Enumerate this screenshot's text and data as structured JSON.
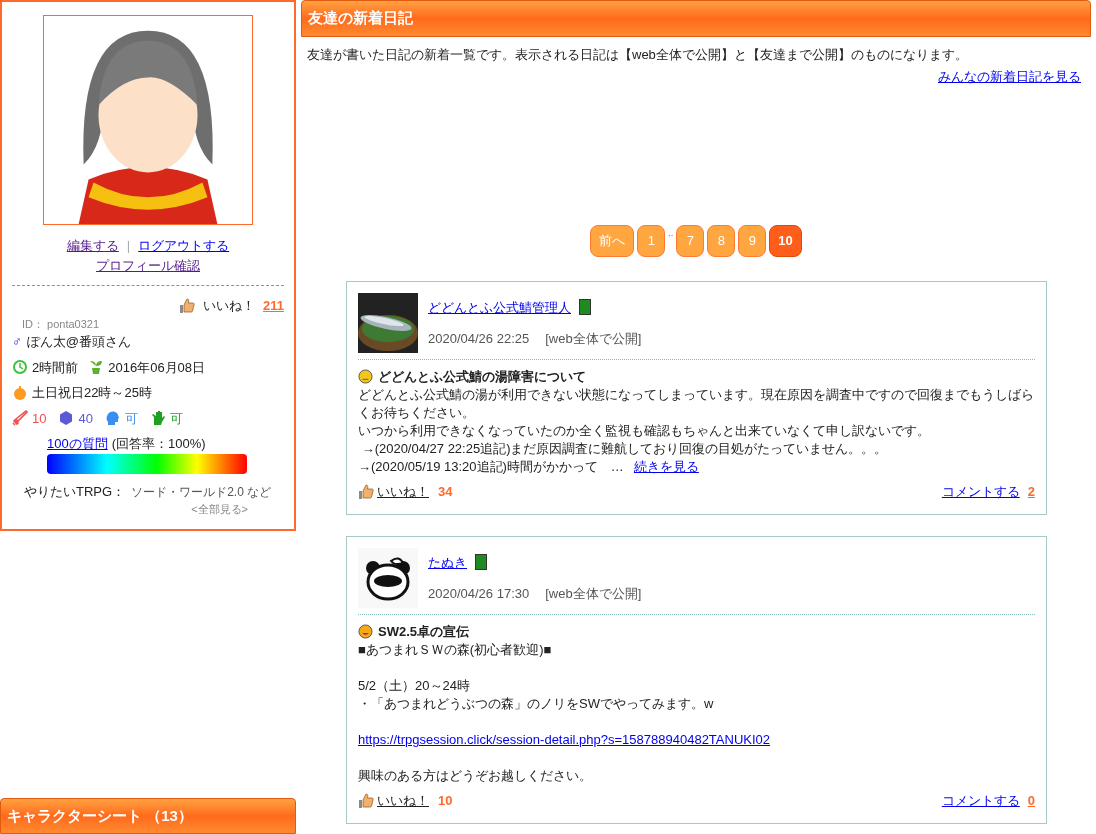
{
  "profile": {
    "links": [
      "編集する",
      "ログアウトする"
    ],
    "separator": "|",
    "profile_link": "プロフィール確認",
    "likes_label": "いいね！",
    "likes_count": "211",
    "id": "ID： ponta0321",
    "gender_mark": "♂",
    "name": "ぽん太@番頭さん",
    "last_login": "2時間前",
    "joined": "2016年06月08日",
    "schedule": "土日祝日22時～25時",
    "stats": [
      {
        "kind": "sword",
        "text": "10",
        "color": "#f05050"
      },
      {
        "kind": "dice",
        "text": "40",
        "color": "#5a5ad8"
      },
      {
        "kind": "head",
        "text": "可",
        "color": "#3a8ef0"
      },
      {
        "kind": "hand",
        "text": "可",
        "color": "#20a020"
      }
    ],
    "questions_link": "100の質問",
    "answer_rate": "(回答率：100%)",
    "trpg_label": "やりたいTRPG：",
    "trpg_value": "ソード・ワールド2.0 など",
    "see_all": "<全部見る>"
  },
  "sidebar_section": {
    "title": "キャラクターシート （13）"
  },
  "main": {
    "title": "友達の新着日記",
    "description": "友達が書いた日記の新着一覧です。表示される日記は【web全体で公開】と【友達まで公開】のものになります。",
    "all_link": "みんなの新着日記を見る"
  },
  "pagination": [
    {
      "kind": "page",
      "label": "前へ",
      "selected": false
    },
    {
      "kind": "page",
      "label": "1",
      "selected": false
    },
    {
      "kind": "gap",
      "label": "‥"
    },
    {
      "kind": "page",
      "label": "7",
      "selected": false
    },
    {
      "kind": "page",
      "label": "8",
      "selected": false
    },
    {
      "kind": "page",
      "label": "9",
      "selected": false
    },
    {
      "kind": "page",
      "label": "10",
      "selected": true
    }
  ],
  "posts": [
    {
      "author": "どどんとふ公式鯖管理人",
      "date": "2020/04/26 22:25",
      "visibility": "[web全体で公開]",
      "mood": {
        "kind": "neutral"
      },
      "title": "どどんとふ公式鯖の湯障害について",
      "body": [
        {
          "kind": "text",
          "text": "どどんとふ公式鯖の湯が利用できない状態になってしまっています。現在原因を調査中ですので回復までもうしばらくお待ちください。"
        },
        {
          "kind": "text",
          "text": "いつから利用できなくなっていたのか全く監視も確認もちゃんと出来ていなくて申し訳ないです。"
        },
        {
          "kind": "text",
          "text": " →(2020/04/27 22:25追記)まだ原因調査に難航しており回復の目処がたっていません。。。"
        },
        {
          "kind": "more",
          "text": "→(2020/05/19 13:20追記)時間がかかって　…",
          "link": "続きを見る"
        }
      ],
      "like_label": "いいね！",
      "like_count": "34",
      "comment_label": "コメントする",
      "comment_count": "2"
    },
    {
      "avatar": {
        "kind": "animal"
      },
      "author": "たぬき",
      "date": "2020/04/26 17:30",
      "visibility": "[web全体で公開]",
      "mood": {
        "kind": "laugh"
      },
      "title": "SW2.5卓の宣伝",
      "body": [
        {
          "kind": "text",
          "text": "■あつまれＳＷの森(初心者歓迎)■"
        },
        {
          "kind": "blank"
        },
        {
          "kind": "text",
          "text": "5/2（土）20～24時"
        },
        {
          "kind": "text",
          "text": "・「あつまれどうぶつの森」のノリをSWでやってみます。w"
        },
        {
          "kind": "blank"
        },
        {
          "kind": "link",
          "text": "https://trpgsession.click/session-detail.php?s=158788940482TANUKI02"
        },
        {
          "kind": "blank"
        },
        {
          "kind": "text",
          "text": "興味のある方はどうぞお越しください。"
        }
      ],
      "like_label": "いいね！",
      "like_count": "10",
      "comment_label": "コメントする",
      "comment_count": "0"
    }
  ]
}
